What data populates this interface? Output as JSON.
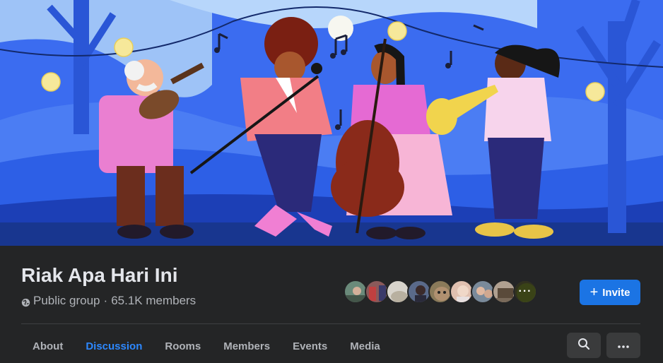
{
  "group": {
    "name": "Riak Apa Hari Ini",
    "privacy_icon": "globe-icon",
    "privacy_label": "Public group",
    "separator": "·",
    "member_count": "65.1K members"
  },
  "members_preview": {
    "avatar_colors": [
      "#6a8a7a",
      "#8a5a5a",
      "#d8d4cc",
      "#5a6a8a",
      "#8a7a5a",
      "#e0c0b0",
      "#7a8a9a",
      "#b0a090",
      "#5a5a3a"
    ],
    "more_label": "···"
  },
  "actions": {
    "invite_label": "Invite",
    "invite_icon": "plus-icon",
    "search_icon": "search-icon",
    "more_icon": "more-horizontal-icon"
  },
  "tabs": [
    {
      "label": "About",
      "active": false
    },
    {
      "label": "Discussion",
      "active": true
    },
    {
      "label": "Rooms",
      "active": false
    },
    {
      "label": "Members",
      "active": false
    },
    {
      "label": "Events",
      "active": false
    },
    {
      "label": "Media",
      "active": false
    }
  ],
  "colors": {
    "background": "#242526",
    "accent": "#2d88ff",
    "button_primary": "#1b74e4",
    "text_primary": "#e4e6eb",
    "text_secondary": "#b0b3b8"
  }
}
